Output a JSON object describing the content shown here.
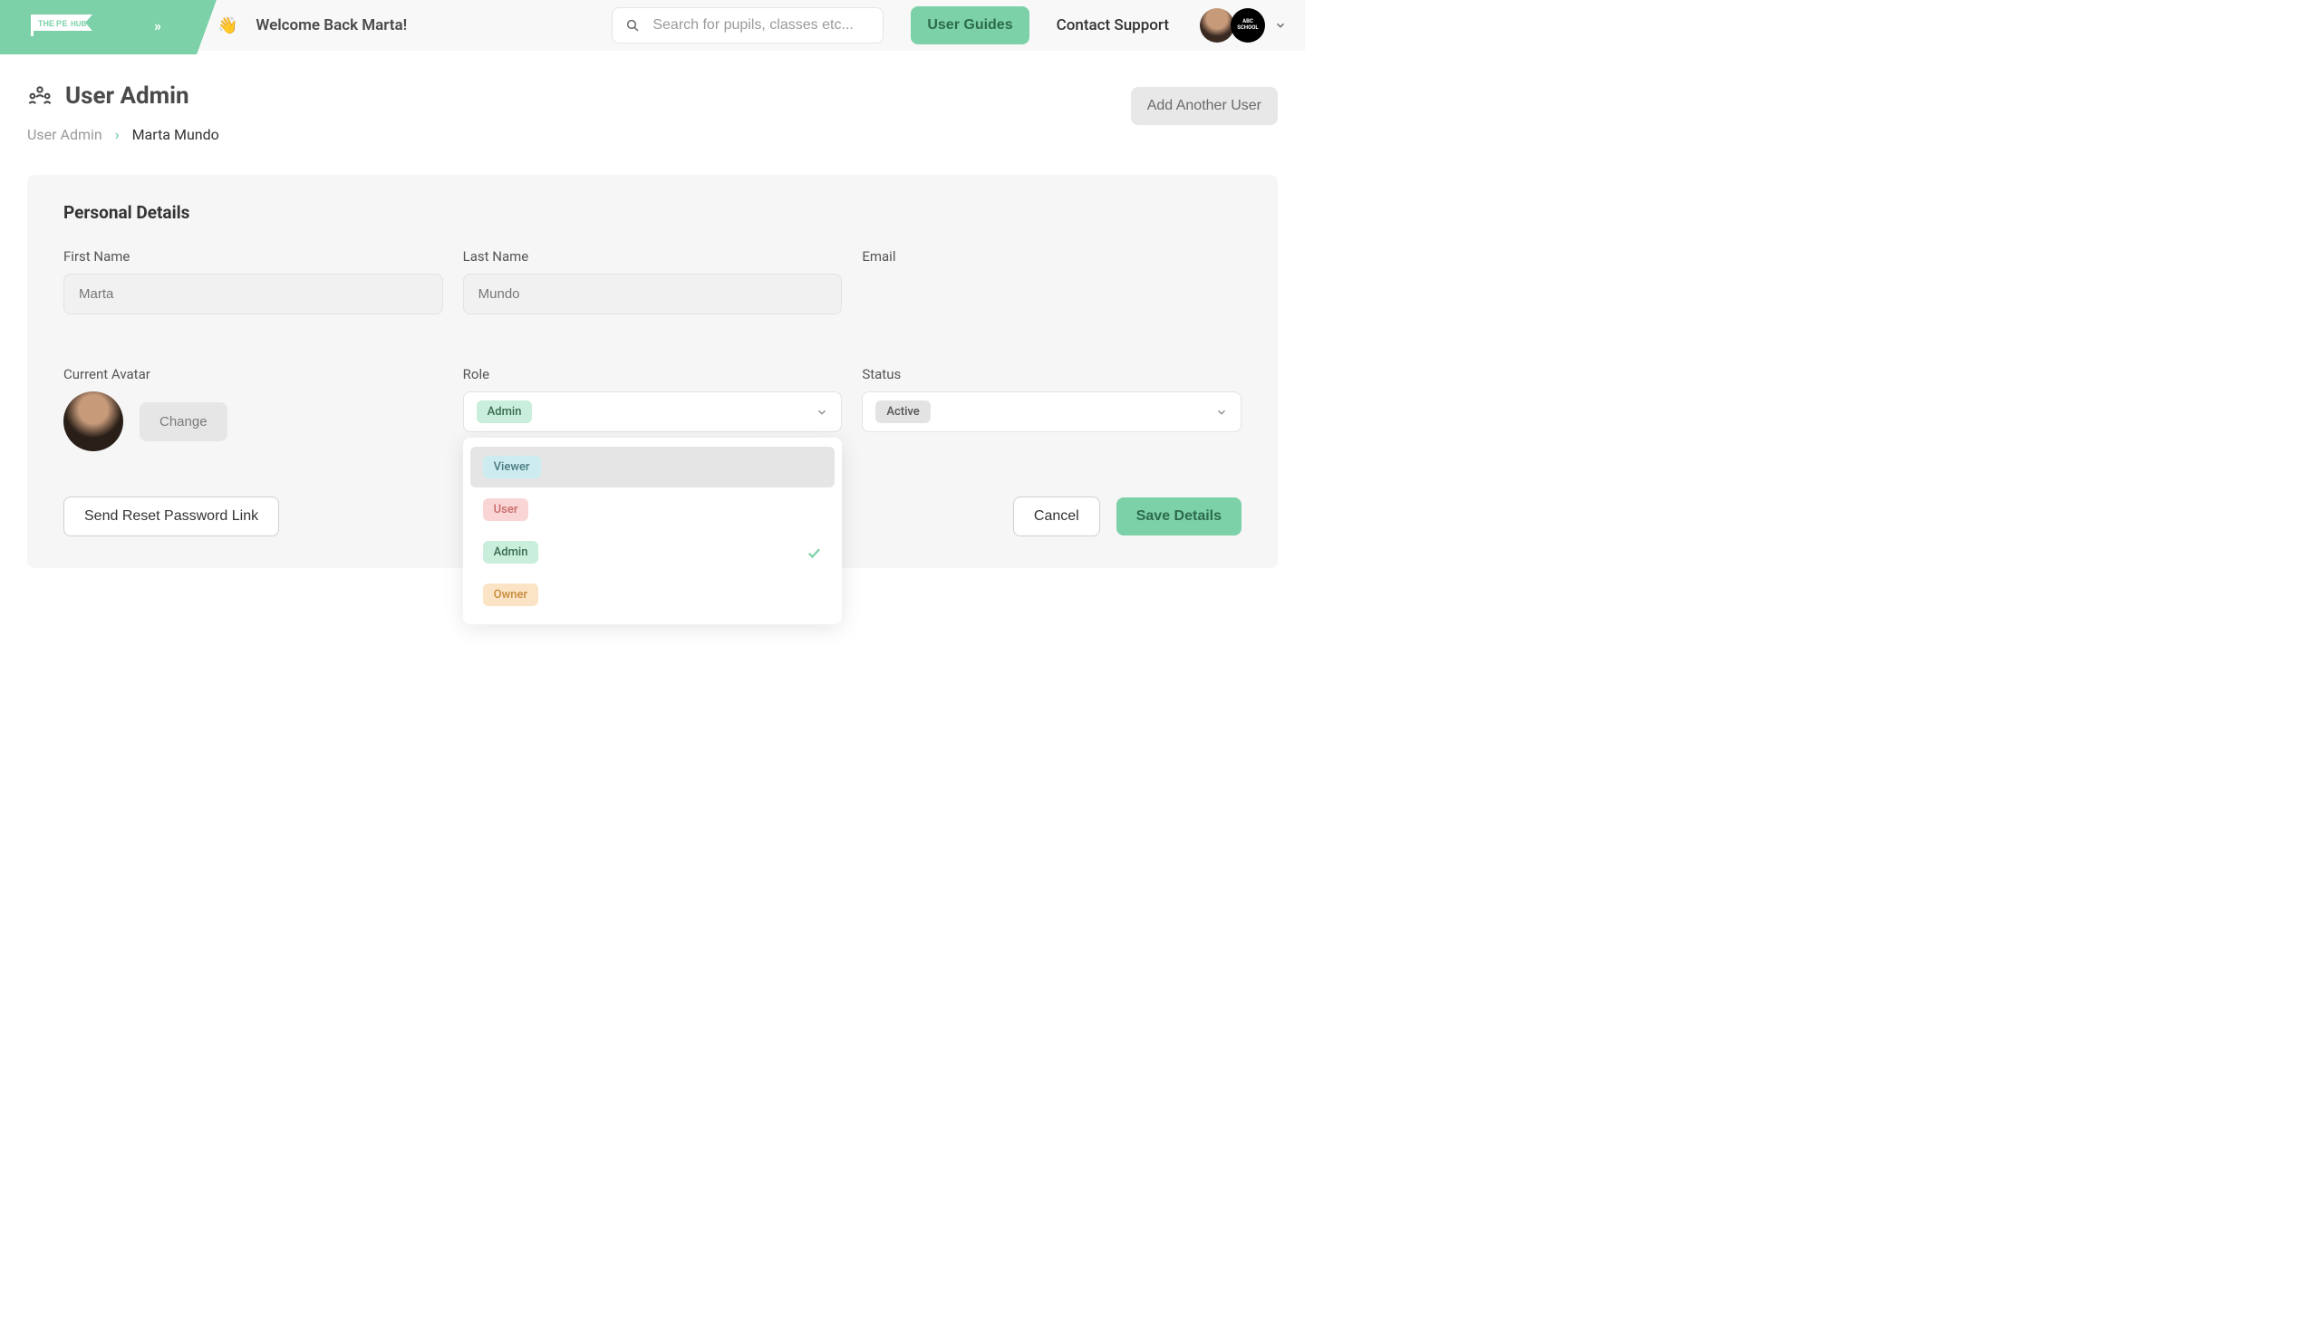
{
  "header": {
    "logo_text": "THE PE HUB",
    "welcome": "Welcome Back Marta!",
    "search_placeholder": "Search for pupils, classes etc...",
    "user_guides": "User Guides",
    "contact_support": "Contact Support",
    "badge_text_top": "ABC",
    "badge_text_bottom": "SCHOOL"
  },
  "page": {
    "title": "User Admin",
    "breadcrumb": {
      "root": "User Admin",
      "current": "Marta Mundo"
    },
    "add_user": "Add Another User"
  },
  "panel": {
    "section_title": "Personal Details",
    "fields": {
      "first_name": {
        "label": "First Name",
        "value": "Marta"
      },
      "last_name": {
        "label": "Last Name",
        "value": "Mundo"
      },
      "email": {
        "label": "Email",
        "value": ""
      },
      "avatar": {
        "label": "Current Avatar",
        "change": "Change"
      },
      "role": {
        "label": "Role",
        "selected": "Admin",
        "options": [
          "Viewer",
          "User",
          "Admin",
          "Owner"
        ]
      },
      "status": {
        "label": "Status",
        "selected": "Active"
      }
    },
    "actions": {
      "reset": "Send Reset Password Link",
      "cancel": "Cancel",
      "save": "Save Details"
    }
  }
}
